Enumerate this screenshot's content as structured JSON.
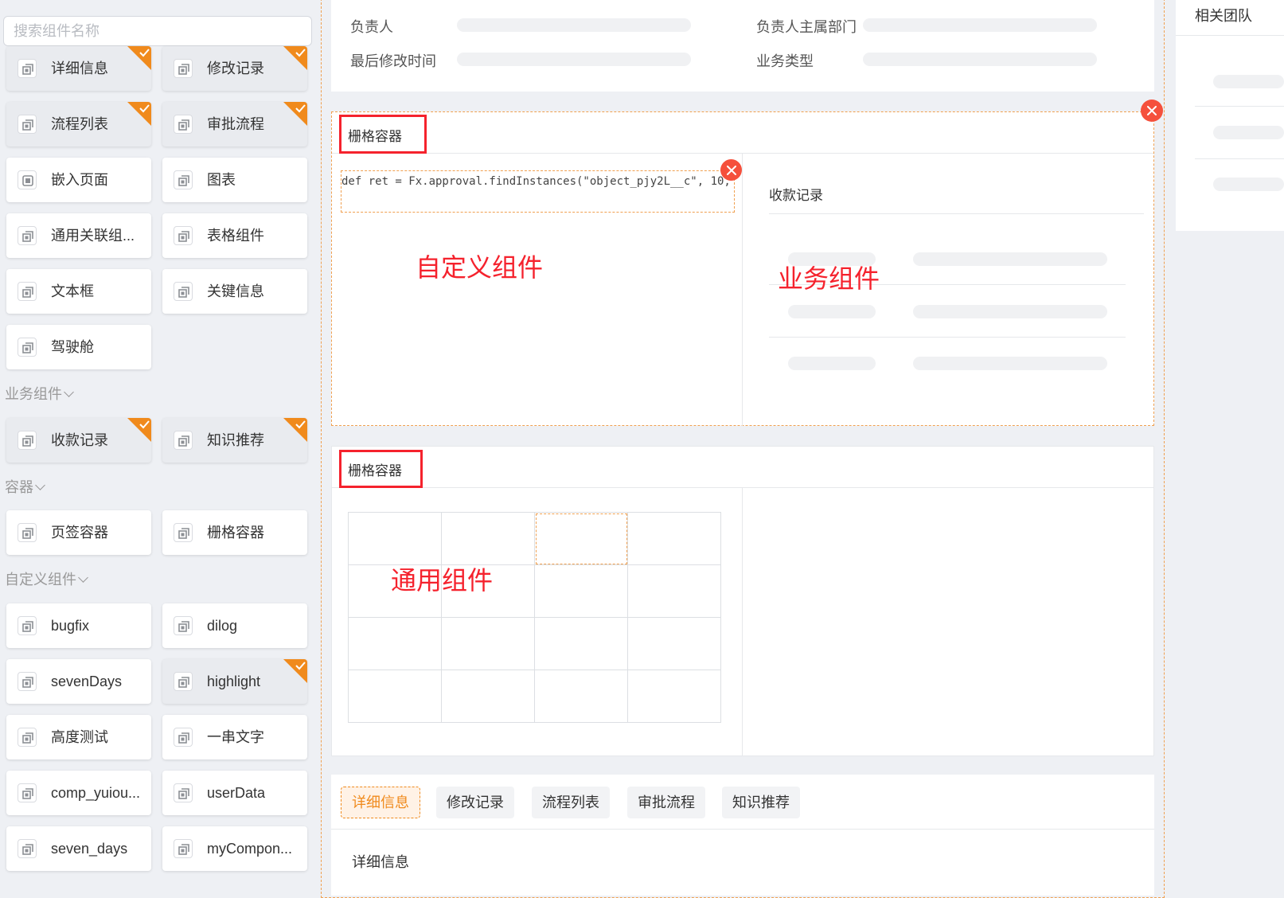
{
  "search": {
    "placeholder": "搜索组件名称"
  },
  "general_components": [
    {
      "label": "详细信息",
      "used": true
    },
    {
      "label": "修改记录",
      "used": true
    },
    {
      "label": "流程列表",
      "used": true
    },
    {
      "label": "审批流程",
      "used": true
    },
    {
      "label": "嵌入页面",
      "used": false,
      "icon": "embed-icon"
    },
    {
      "label": "图表",
      "used": false
    },
    {
      "label": "通用关联组...",
      "used": false
    },
    {
      "label": "表格组件",
      "used": false
    },
    {
      "label": "文本框",
      "used": false
    },
    {
      "label": "关键信息",
      "used": false
    },
    {
      "label": "驾驶舱",
      "used": false
    }
  ],
  "business_section": {
    "label": "业务组件"
  },
  "business_components": [
    {
      "label": "收款记录",
      "used": true
    },
    {
      "label": "知识推荐",
      "used": true
    }
  ],
  "container_section": {
    "label": "容器"
  },
  "container_components": [
    {
      "label": "页签容器",
      "used": false
    },
    {
      "label": "栅格容器",
      "used": false
    }
  ],
  "custom_section": {
    "label": "自定义组件"
  },
  "custom_components": [
    {
      "label": "bugfix",
      "used": false
    },
    {
      "label": "dilog",
      "used": false
    },
    {
      "label": "sevenDays",
      "used": false
    },
    {
      "label": "highlight",
      "used": true
    },
    {
      "label": "高度测试",
      "used": false
    },
    {
      "label": "一串文字",
      "used": false
    },
    {
      "label": "comp_yuiou...",
      "used": false
    },
    {
      "label": "userData",
      "used": false
    },
    {
      "label": "seven_days",
      "used": false
    },
    {
      "label": "myCompon...",
      "used": false
    }
  ],
  "info_card": {
    "owner_label": "负责人",
    "owner_dept_label": "负责人主属部门",
    "last_modified_label": "最后修改时间",
    "biz_type_label": "业务类型"
  },
  "grid1": {
    "title": "栅格容器",
    "code": "def ret = Fx.approval.findInstances(\"object_pjy2L__c\", 10,",
    "left_annotation": "自定义组件",
    "right_title": "收款记录",
    "right_annotation": "业务组件"
  },
  "grid2": {
    "title": "栅格容器",
    "annotation": "通用组件"
  },
  "tabs": {
    "items": [
      "详细信息",
      "修改记录",
      "流程列表",
      "审批流程",
      "知识推荐"
    ],
    "active_index": 0,
    "content_title": "详细信息"
  },
  "right_panel": {
    "title": "相关团队"
  },
  "colors": {
    "accent": "#f08a1c",
    "annotation_red": "#f5222d",
    "close_red": "#f5503c"
  }
}
